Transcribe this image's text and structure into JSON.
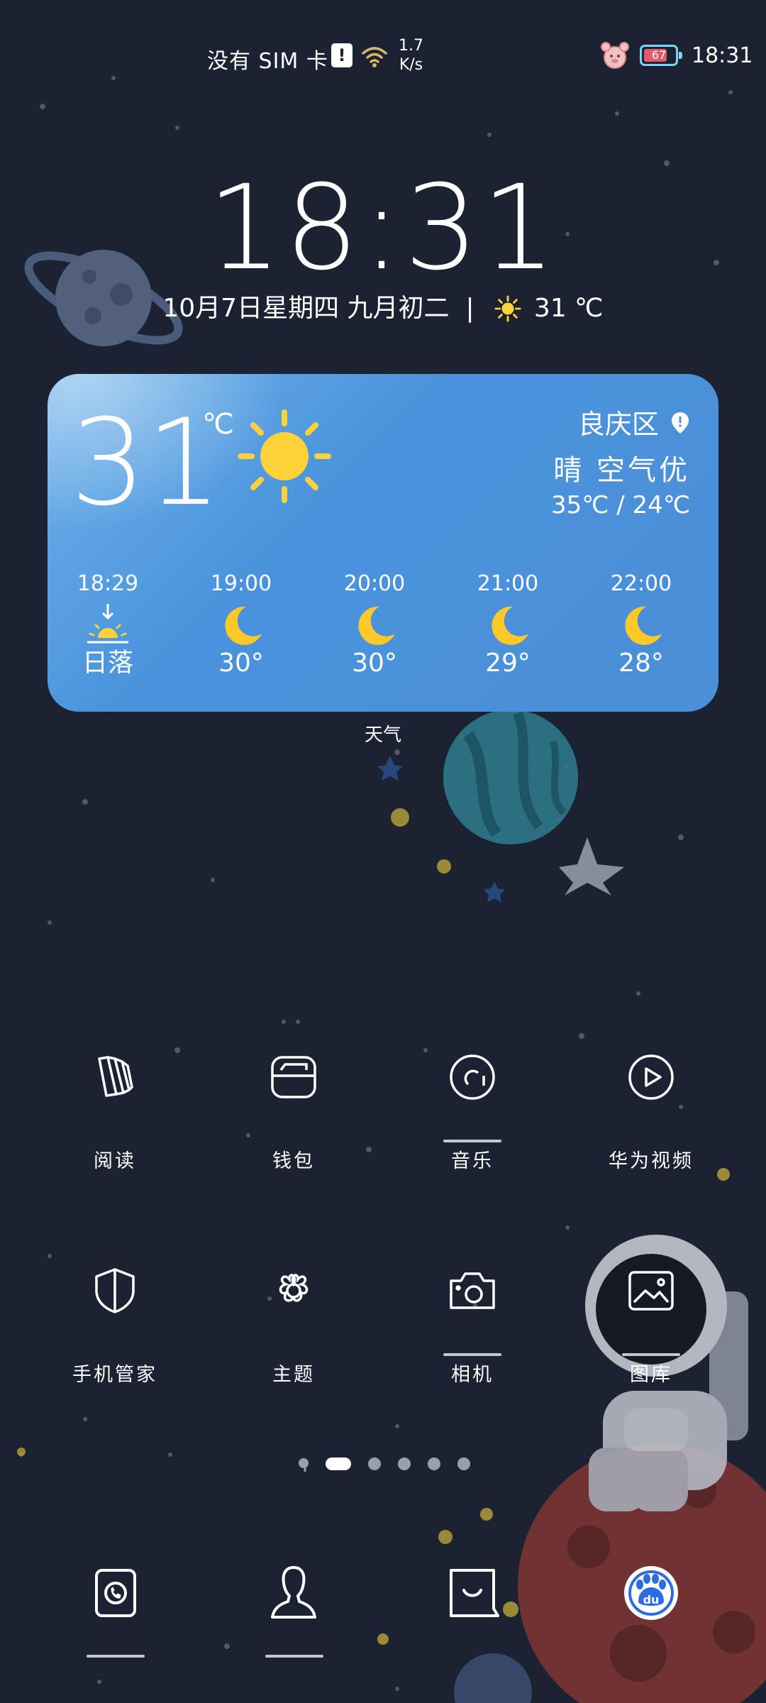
{
  "status_bar": {
    "carrier": "没有 SIM 卡",
    "alert": "!",
    "net_speed_value": "1.7",
    "net_speed_unit": "K/s",
    "battery": "67",
    "time": "18:31",
    "icons": [
      "sim-alert-icon",
      "wifi-icon",
      "alarm-icon",
      "battery-icon"
    ]
  },
  "lockclock": {
    "time": "18:31",
    "date": "10月7日星期四 九月初二",
    "temp": "31 ℃"
  },
  "weather": {
    "temperature": "31",
    "unit": "℃",
    "location": "良庆区",
    "condition": "晴 空气优",
    "range": "35℃ / 24℃",
    "hourly": [
      {
        "time": "18:29",
        "icon": "sunset-icon",
        "value": "日落"
      },
      {
        "time": "19:00",
        "icon": "moon-icon",
        "value": "30°"
      },
      {
        "time": "20:00",
        "icon": "moon-icon",
        "value": "30°"
      },
      {
        "time": "21:00",
        "icon": "moon-icon",
        "value": "29°"
      },
      {
        "time": "22:00",
        "icon": "moon-icon",
        "value": "28°"
      }
    ],
    "widget_label": "天气"
  },
  "apps": [
    {
      "label": "阅读",
      "icon": "books-icon"
    },
    {
      "label": "钱包",
      "icon": "wallet-icon"
    },
    {
      "label": "音乐",
      "icon": "music-icon"
    },
    {
      "label": "华为视频",
      "icon": "video-icon"
    },
    {
      "label": "手机管家",
      "icon": "shield-icon"
    },
    {
      "label": "主题",
      "icon": "theme-flower-icon"
    },
    {
      "label": "相机",
      "icon": "camera-icon"
    },
    {
      "label": "图库",
      "icon": "gallery-icon"
    }
  ],
  "pages": {
    "count": 6,
    "active": 1
  },
  "dock": [
    {
      "icon": "phone-icon"
    },
    {
      "icon": "contacts-icon"
    },
    {
      "icon": "messages-icon"
    },
    {
      "icon": "baidu-icon",
      "text": "du"
    }
  ],
  "colors": {
    "background": "#1b2232",
    "card": "#4a93dc",
    "sun": "#ffd23a",
    "moon": "#ffc928"
  }
}
